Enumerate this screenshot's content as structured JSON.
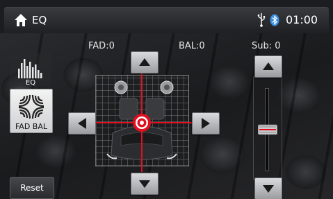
{
  "header": {
    "title": "EQ",
    "clock": "01:00",
    "icons": [
      "home-icon",
      "usb-icon",
      "bluetooth-icon"
    ]
  },
  "labels": {
    "fad": "FAD:0",
    "bal": "BAL:0",
    "sub": "Sub: 0"
  },
  "sidebar": {
    "eq_label": "EQ",
    "fadbal_label": "FAD BAL",
    "reset_label": "Reset"
  },
  "values": {
    "fader": 0,
    "balance": 0,
    "subwoofer": 0
  },
  "colors": {
    "crosshair": "#e01020",
    "accent_bluetooth": "#3a8fe0"
  }
}
